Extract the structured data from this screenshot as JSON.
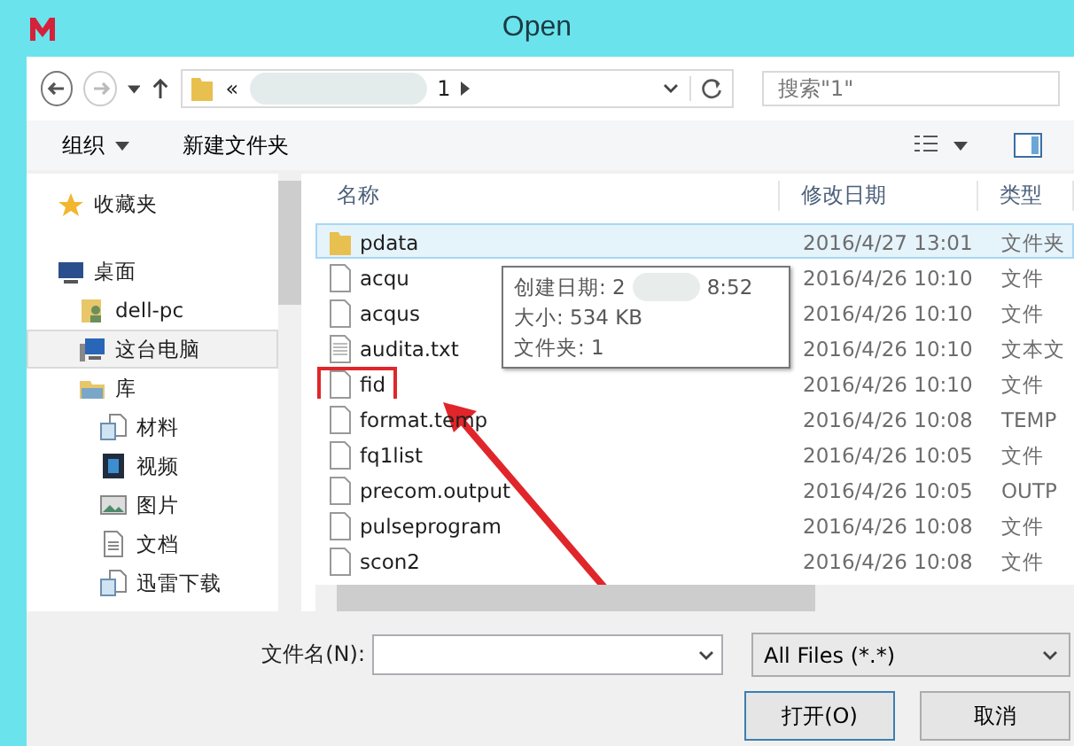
{
  "window": {
    "title": "Open"
  },
  "nav": {
    "path_prefix": "«",
    "path_segment": "1",
    "search": {
      "placeholder": "搜索\"1\""
    }
  },
  "toolbar": {
    "organize": "组织",
    "new_folder": "新建文件夹"
  },
  "sidebar": {
    "items": [
      {
        "label": "收藏夹",
        "kind": "star",
        "selected": false
      },
      {
        "label": "桌面",
        "kind": "desktop",
        "selected": false,
        "children": [
          {
            "label": "dell-pc",
            "kind": "user",
            "selected": false
          },
          {
            "label": "这台电脑",
            "kind": "computer",
            "selected": true
          },
          {
            "label": "库",
            "kind": "library",
            "selected": false,
            "children": [
              {
                "label": "材料",
                "kind": "docs",
                "selected": false
              },
              {
                "label": "视频",
                "kind": "video",
                "selected": false
              },
              {
                "label": "图片",
                "kind": "image",
                "selected": false
              },
              {
                "label": "文档",
                "kind": "text",
                "selected": false
              },
              {
                "label": "迅雷下载",
                "kind": "docs",
                "selected": false
              }
            ]
          }
        ]
      }
    ]
  },
  "file_list": {
    "columns": [
      "名称",
      "修改日期",
      "类型"
    ],
    "rows": [
      {
        "name": "pdata",
        "date": "2016/4/27 13:01",
        "type": "文件夹",
        "kind": "folder",
        "selected": true,
        "marked": false
      },
      {
        "name": "acqu",
        "date": "2016/4/26 10:10",
        "type": "文件",
        "kind": "file",
        "selected": false,
        "marked": false
      },
      {
        "name": "acqus",
        "date": "2016/4/26 10:10",
        "type": "文件",
        "kind": "file",
        "selected": false,
        "marked": false
      },
      {
        "name": "audita.txt",
        "date": "2016/4/26 10:10",
        "type": "文本文",
        "kind": "text",
        "selected": false,
        "marked": false
      },
      {
        "name": "fid",
        "date": "2016/4/26 10:10",
        "type": "文件",
        "kind": "file",
        "selected": false,
        "marked": true
      },
      {
        "name": "format.temp",
        "date": "2016/4/26 10:08",
        "type": "TEMP",
        "kind": "file",
        "selected": false,
        "marked": false
      },
      {
        "name": "fq1list",
        "date": "2016/4/26 10:05",
        "type": "文件",
        "kind": "file",
        "selected": false,
        "marked": false
      },
      {
        "name": "precom.output",
        "date": "2016/4/26 10:05",
        "type": "OUTP",
        "kind": "file",
        "selected": false,
        "marked": false
      },
      {
        "name": "pulseprogram",
        "date": "2016/4/26 10:08",
        "type": "文件",
        "kind": "file",
        "selected": false,
        "marked": false
      },
      {
        "name": "scon2",
        "date": "2016/4/26 10:08",
        "type": "文件",
        "kind": "file",
        "selected": false,
        "marked": false
      }
    ]
  },
  "tooltip": {
    "lines": [
      {
        "text": "创建日期: 2",
        "tail": "8:52"
      },
      {
        "text": "大小: 534 KB"
      },
      {
        "text": "文件夹: 1"
      }
    ]
  },
  "filename": {
    "label": "文件名(N):"
  },
  "filter": {
    "value": "All Files (*.*)"
  },
  "buttons": [
    {
      "label": "打开(O)",
      "default": true
    },
    {
      "label": "取消",
      "default": false
    }
  ]
}
